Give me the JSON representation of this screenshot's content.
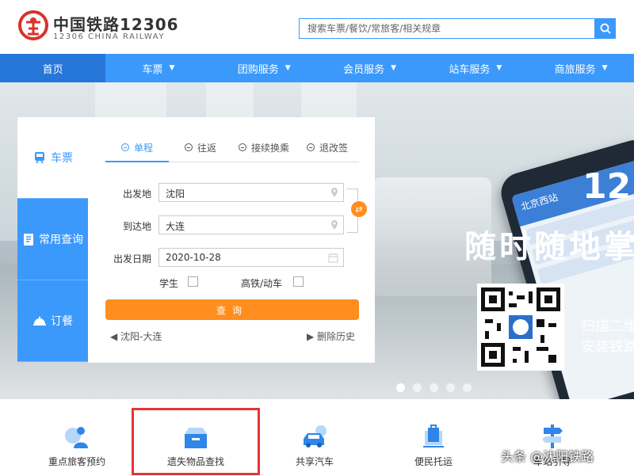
{
  "brand": {
    "name_cn": "中国铁路12306",
    "name_en": "12306 CHINA RAILWAY"
  },
  "search": {
    "placeholder": "搜索车票/餐饮/常旅客/相关规章"
  },
  "nav": {
    "items": [
      {
        "label": "首页",
        "active": true
      },
      {
        "label": "车票",
        "chevron": true
      },
      {
        "label": "团购服务",
        "chevron": true
      },
      {
        "label": "会员服务",
        "chevron": true
      },
      {
        "label": "站车服务",
        "chevron": true
      },
      {
        "label": "商旅服务",
        "chevron": true
      }
    ]
  },
  "side_tabs": [
    {
      "label": "车票",
      "icon": "train-icon",
      "active": true
    },
    {
      "label": "常用查询",
      "icon": "document-icon"
    },
    {
      "label": "订餐",
      "icon": "dining-icon"
    }
  ],
  "trip_tabs": [
    {
      "label": "单程",
      "active": true
    },
    {
      "label": "往返"
    },
    {
      "label": "接续换乘"
    },
    {
      "label": "退改签"
    }
  ],
  "form": {
    "from_label": "出发地",
    "from_value": "沈阳",
    "to_label": "到达地",
    "to_value": "大连",
    "date_label": "出发日期",
    "date_value": "2020-10-28",
    "student_label": "学生",
    "highspeed_label": "高铁/动车",
    "query_label": "查询",
    "history_route": "沈阳-大连",
    "history_clear": "删除历史"
  },
  "banner": {
    "big_text": "12",
    "slogan": "随时随地掌",
    "qr_line1": "扫描二维",
    "qr_line2": "安装铁路",
    "phone_screen_title": "北京西站",
    "carousel_count": 5,
    "carousel_active": 0
  },
  "services": [
    {
      "label": "重点旅客预约",
      "icon": "wheelchair-person-icon"
    },
    {
      "label": "遗失物品查找",
      "icon": "lost-box-icon"
    },
    {
      "label": "共享汽车",
      "icon": "shared-car-icon"
    },
    {
      "label": "便民托运",
      "icon": "luggage-cart-icon"
    },
    {
      "label": "车站引导",
      "icon": "signpost-icon"
    }
  ],
  "watermark": "头条 @沈阳铁路",
  "colors": {
    "primary": "#3b99fc",
    "nav_active": "#2675d9",
    "accent": "#ff8e1e",
    "highlight": "#e63434"
  }
}
